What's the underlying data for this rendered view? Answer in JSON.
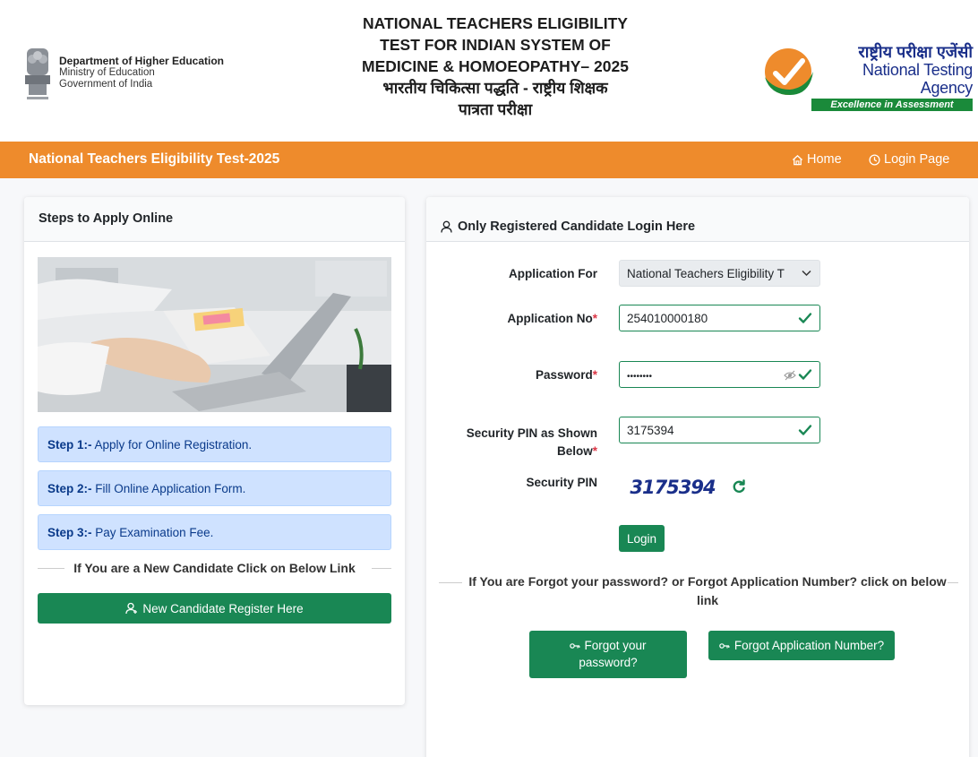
{
  "header": {
    "dept_name": "Department of Higher Education",
    "ministry": "Ministry of Education",
    "government": "Government of India",
    "exam_title_lines": [
      "NATIONAL TEACHERS ELIGIBILITY",
      "TEST FOR INDIAN SYSTEM OF",
      "MEDICINE & HOMOEOPATHY– 2025",
      "भारतीय चिकित्सा पद्धति - राष्ट्रीय शिक्षक",
      "पात्रता परीक्षा"
    ],
    "agency_hindi": "राष्ट्रीय परीक्षा एजेंसी",
    "agency_english": "National Testing Agency",
    "agency_tagline": "Excellence in Assessment"
  },
  "navbar": {
    "brand": "National Teachers Eligibility Test-2025",
    "home": "Home",
    "login_page": "Login Page"
  },
  "steps_card": {
    "title": "Steps to Apply Online",
    "steps": [
      {
        "label": "Step 1:-",
        "text": "Apply for Online Registration."
      },
      {
        "label": "Step 2:-",
        "text": "Fill Online Application Form."
      },
      {
        "label": "Step 3:-",
        "text": "Pay Examination Fee."
      }
    ],
    "new_candidate_text": "If You are a New Candidate Click on Below Link",
    "register_button": "New Candidate Register Here"
  },
  "login_card": {
    "title": "Only Registered Candidate Login Here",
    "application_for_label": "Application For",
    "application_for_value": "National Teachers Eligibility T",
    "application_no_label": "Application No",
    "application_no_value": "254010000180",
    "password_label": "Password",
    "password_value": "••••••••",
    "security_pin_label_1": "Security PIN as Shown",
    "security_pin_label_2": "Below",
    "security_pin_value": "3175394",
    "captcha_label": "Security PIN",
    "captcha_text": "3175394",
    "login_button": "Login",
    "forgot_text_1": "If You are Forgot your password? or Forgot Application Number? click on below",
    "forgot_text_2": "link",
    "forgot_password_1": "Forgot your",
    "forgot_password_2": "password?",
    "forgot_application": "Forgot Application Number?"
  },
  "colors": {
    "accent_orange": "#ee8b2c",
    "success_green": "#198754",
    "step_bg": "#cfe2ff"
  }
}
